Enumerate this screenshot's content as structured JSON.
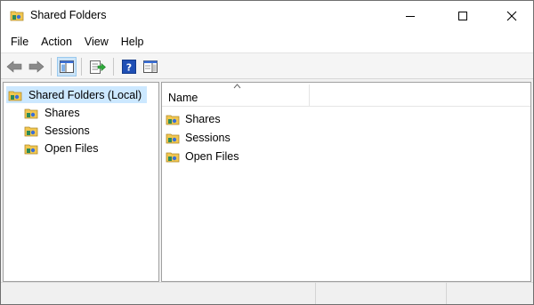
{
  "window": {
    "title": "Shared Folders",
    "app_icon": "shared-folders-icon"
  },
  "caption_buttons": {
    "minimize_icon": "minimize-icon",
    "maximize_icon": "maximize-icon",
    "close_icon": "close-icon"
  },
  "menu": {
    "items": [
      {
        "label": "File"
      },
      {
        "label": "Action"
      },
      {
        "label": "View"
      },
      {
        "label": "Help"
      }
    ]
  },
  "toolbar": {
    "buttons": [
      {
        "name": "back-icon"
      },
      {
        "name": "forward-icon"
      },
      {
        "name": "show-hide-console-tree-icon",
        "active": true
      },
      {
        "name": "export-list-icon"
      },
      {
        "name": "help-icon"
      },
      {
        "name": "show-hide-action-pane-icon"
      }
    ]
  },
  "tree": {
    "root": {
      "label": "Shared Folders (Local)",
      "selected": true
    },
    "children": [
      {
        "label": "Shares"
      },
      {
        "label": "Sessions"
      },
      {
        "label": "Open Files"
      }
    ]
  },
  "list": {
    "columns": [
      {
        "label": "Name",
        "sort": "ascending"
      }
    ],
    "rows": [
      {
        "label": "Shares"
      },
      {
        "label": "Sessions"
      },
      {
        "label": "Open Files"
      }
    ]
  },
  "colors": {
    "selection": "#cce8ff",
    "toolbar_active": "#cce4f7",
    "folder_yellow": "#f2c74f",
    "help_blue": "#1f4fb5"
  }
}
